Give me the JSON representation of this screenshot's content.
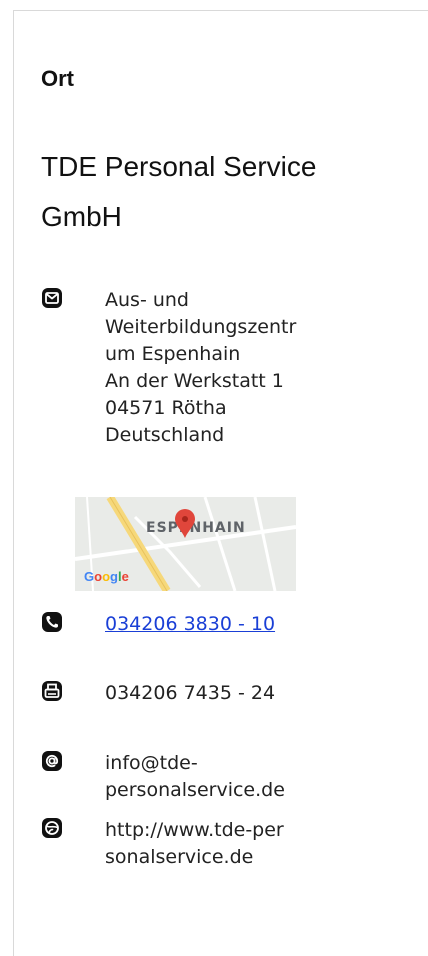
{
  "section_label": "Ort",
  "company_name": "TDE Personal Service GmbH",
  "address": {
    "icon": "mail-icon",
    "lines": [
      "Aus- und",
      "Weiterbildungszentr",
      "um Espenhain",
      "An der Werkstatt 1",
      "04571 Rötha",
      "Deutschland"
    ]
  },
  "map": {
    "place_label": "ESPENHAIN",
    "provider_label": "Google",
    "colors": {
      "road_yellow": "#f6d87a",
      "pin_red": "#e0463b",
      "background": "#e9ebe8"
    }
  },
  "phone": {
    "icon": "phone-icon",
    "value": "034206 3830 - 10"
  },
  "fax": {
    "icon": "fax-icon",
    "value": "034206 7435 - 24"
  },
  "email": {
    "icon": "at-icon",
    "lines": [
      "info@tde-",
      "personalservice.de"
    ]
  },
  "website": {
    "icon": "globe-icon",
    "lines": [
      "http://www.tde-per",
      "sonalservice.de"
    ]
  },
  "colors": {
    "link": "#1a3fd6",
    "text": "#222222",
    "border": "#d9d9d9"
  }
}
